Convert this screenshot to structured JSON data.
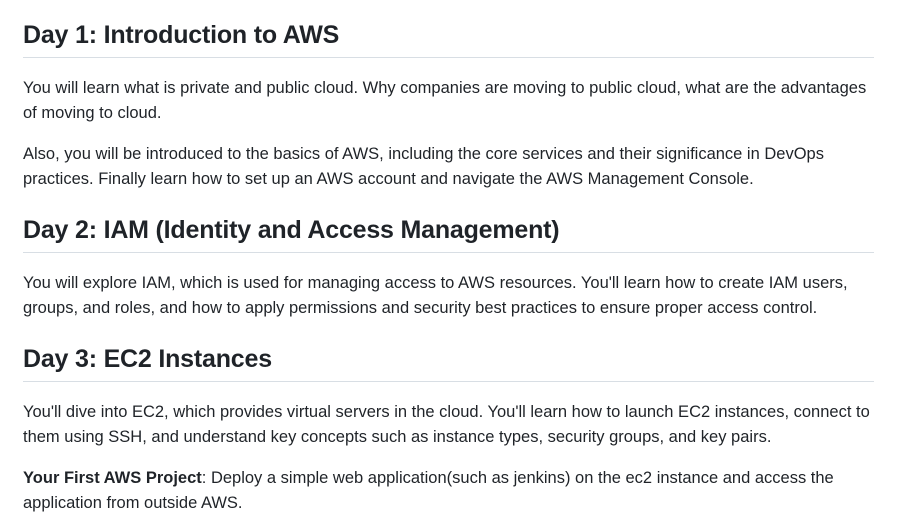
{
  "sections": [
    {
      "heading": "Day 1: Introduction to AWS",
      "paragraphs": [
        "You will learn what is private and public cloud. Why companies are moving to public cloud, what are the advantages of moving to cloud.",
        "Also, you will be introduced to the basics of AWS, including the core services and their significance in DevOps practices. Finally learn how to set up an AWS account and navigate the AWS Management Console."
      ]
    },
    {
      "heading": "Day 2: IAM (Identity and Access Management)",
      "paragraphs": [
        "You will explore IAM, which is used for managing access to AWS resources. You'll learn how to create IAM users, groups, and roles, and how to apply permissions and security best practices to ensure proper access control."
      ]
    },
    {
      "heading": "Day 3: EC2 Instances",
      "paragraphs": [
        "You'll dive into EC2, which provides virtual servers in the cloud. You'll learn how to launch EC2 instances, connect to them using SSH, and understand key concepts such as instance types, security groups, and key pairs."
      ],
      "project": {
        "label": "Your First AWS Project",
        "text": ": Deploy a simple web application(such as jenkins) on the ec2 instance and access the application from outside AWS."
      }
    }
  ]
}
